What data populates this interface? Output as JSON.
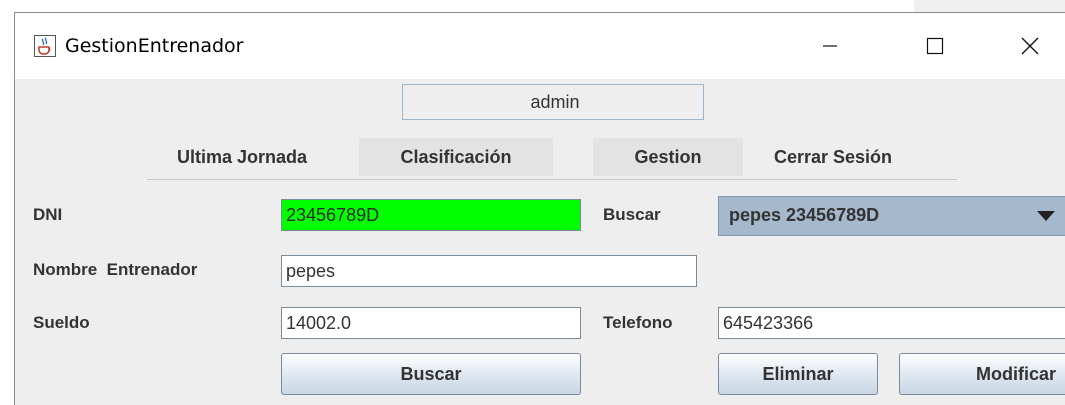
{
  "window": {
    "title": "GestionEntrenador",
    "icon": "java-cup-icon"
  },
  "titlebar_controls": {
    "minimize": "—",
    "maximize": "☐",
    "close": "✕"
  },
  "user": {
    "name": "admin"
  },
  "menu": {
    "items": [
      {
        "label": "Ultima Jornada"
      },
      {
        "label": "Clasificación"
      },
      {
        "label": "Gestion"
      },
      {
        "label": "Cerrar Sesión"
      }
    ],
    "selected": "Gestion"
  },
  "form": {
    "dni_label": "DNI",
    "dni_value": "23456789D",
    "buscar_label": "Buscar",
    "buscar_selected": "pepes 23456789D",
    "nombre_label": "Nombre  Entrenador",
    "nombre_value": "pepes",
    "sueldo_label": "Sueldo",
    "sueldo_value": "14002.0",
    "telefono_label": "Telefono",
    "telefono_value": "645423366"
  },
  "buttons": {
    "buscar": "Buscar",
    "eliminar": "Eliminar",
    "modificar": "Modificar"
  },
  "colors": {
    "dni_field_bg": "#00ff00",
    "combo_bg": "#a6b8cc",
    "window_bg": "#eeeeee"
  }
}
